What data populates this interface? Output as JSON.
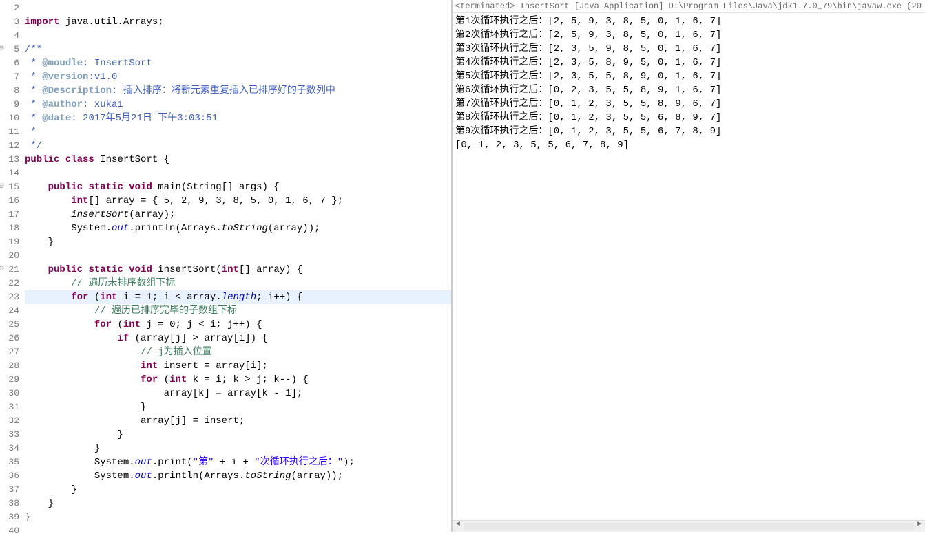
{
  "gutter": {
    "lines": [
      2,
      3,
      4,
      5,
      6,
      7,
      8,
      9,
      10,
      11,
      12,
      13,
      14,
      15,
      16,
      17,
      18,
      19,
      20,
      21,
      22,
      23,
      24,
      25,
      26,
      27,
      28,
      29,
      30,
      31,
      32,
      33,
      34,
      35,
      36,
      37,
      38,
      39,
      40
    ],
    "fold_at": [
      5,
      15,
      21
    ]
  },
  "code": {
    "l3_import": "import",
    "l3_pkg": " java.util.Arrays;",
    "l5": "/**",
    "l6_pre": " * ",
    "l6_tag": "@moudle",
    "l6_post": ": InsertSort",
    "l7_pre": " * ",
    "l7_tag": "@version",
    "l7_post": ":v1.0",
    "l8_pre": " * ",
    "l8_tag": "@Description",
    "l8_post": ": 插入排序：将新元素重复插入已排序好的子数列中",
    "l9_pre": " * ",
    "l9_tag": "@author",
    "l9_post": ": xukai",
    "l10_pre": " * ",
    "l10_tag": "@date",
    "l10_post": ": 2017年5月21日 下午3:03:51",
    "l11": " *",
    "l12": " */",
    "l13_public": "public",
    "l13_class": "class",
    "l13_name": " InsertSort {",
    "l15_public": "public",
    "l15_static": "static",
    "l15_void": "void",
    "l15_main": " main(String[] args) {",
    "l16_int": "int",
    "l16_rest": "[] array = { 5, 2, 9, 3, 8, 5, 0, 1, 6, 7 };",
    "l17": "insertSort",
    "l17_rest": "(array);",
    "l18_pre": "System.",
    "l18_out": "out",
    "l18_mid": ".println(Arrays.",
    "l18_ts": "toString",
    "l18_end": "(array));",
    "l19": "}",
    "l21_public": "public",
    "l21_static": "static",
    "l21_void": "void",
    "l21_method": " insertSort(",
    "l21_int": "int",
    "l21_end": "[] array) {",
    "l22": "// 遍历未排序数组下标",
    "l23_for": "for",
    "l23_pre": " (",
    "l23_int": "int",
    "l23_mid": " i = 1; i < array.",
    "l23_len": "length",
    "l23_end": "; i++) {",
    "l24": "// 遍历已排序完毕的子数组下标",
    "l25_for": "for",
    "l25_pre": " (",
    "l25_int": "int",
    "l25_end": " j = 0; j < i; j++) {",
    "l26_if": "if",
    "l26_end": " (array[j] > array[i]) {",
    "l27": "// j为插入位置",
    "l28_int": "int",
    "l28_end": " insert = array[i];",
    "l29_for": "for",
    "l29_pre": " (",
    "l29_int": "int",
    "l29_end": " k = i; k > j; k--) {",
    "l30": "array[k] = array[k - 1];",
    "l31": "}",
    "l32": "array[j] = insert;",
    "l33": "}",
    "l34": "}",
    "l35_pre": "System.",
    "l35_out": "out",
    "l35_print": ".print(",
    "l35_s1": "\"第\"",
    "l35_mid": " + i + ",
    "l35_s2": "\"次循环执行之后：\"",
    "l35_end": ");",
    "l36_pre": "System.",
    "l36_out": "out",
    "l36_mid": ".println(Arrays.",
    "l36_ts": "toString",
    "l36_end": "(array));",
    "l37": "}",
    "l38": "}",
    "l39": "}"
  },
  "console": {
    "header": "<terminated> InsertSort [Java Application] D:\\Program Files\\Java\\jdk1.7.0_79\\bin\\javaw.exe (20",
    "lines": [
      "第1次循环执行之后：[2, 5, 9, 3, 8, 5, 0, 1, 6, 7]",
      "第2次循环执行之后：[2, 5, 9, 3, 8, 5, 0, 1, 6, 7]",
      "第3次循环执行之后：[2, 3, 5, 9, 8, 5, 0, 1, 6, 7]",
      "第4次循环执行之后：[2, 3, 5, 8, 9, 5, 0, 1, 6, 7]",
      "第5次循环执行之后：[2, 3, 5, 5, 8, 9, 0, 1, 6, 7]",
      "第6次循环执行之后：[0, 2, 3, 5, 5, 8, 9, 1, 6, 7]",
      "第7次循环执行之后：[0, 1, 2, 3, 5, 5, 8, 9, 6, 7]",
      "第8次循环执行之后：[0, 1, 2, 3, 5, 5, 6, 8, 9, 7]",
      "第9次循环执行之后：[0, 1, 2, 3, 5, 5, 6, 7, 8, 9]",
      "[0, 1, 2, 3, 5, 5, 6, 7, 8, 9]"
    ]
  }
}
